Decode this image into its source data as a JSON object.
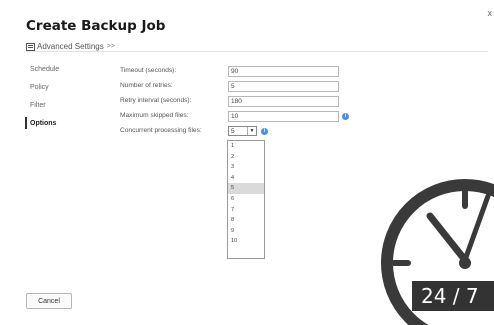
{
  "header": {
    "title": "Create Backup Job",
    "close_label": "x"
  },
  "breadcrumb": {
    "label": "Advanced Settings",
    "arrow": ">>"
  },
  "sidebar": {
    "items": [
      {
        "label": "Schedule"
      },
      {
        "label": "Policy"
      },
      {
        "label": "Filter"
      },
      {
        "label": "Options"
      }
    ]
  },
  "form": {
    "timeout": {
      "label": "Timeout (seconds):",
      "value": "90"
    },
    "retries": {
      "label": "Number of retries:",
      "value": "5"
    },
    "retry_interval": {
      "label": "Retry interval (seconds):",
      "value": "180"
    },
    "max_skipped": {
      "label": "Maximum skipped files:",
      "value": "10"
    },
    "concurrent": {
      "label": "Concurrent processing files:",
      "value": "5"
    }
  },
  "dropdown": {
    "options": [
      "1",
      "2",
      "3",
      "4",
      "5",
      "6",
      "7",
      "8",
      "9",
      "10"
    ],
    "selected": "5"
  },
  "footer": {
    "cancel_label": "Cancel"
  },
  "overlay": {
    "badge_text": "24 / 7"
  },
  "colors": {
    "info_icon": "#4a90d9",
    "clock": "#3a3a3a"
  }
}
